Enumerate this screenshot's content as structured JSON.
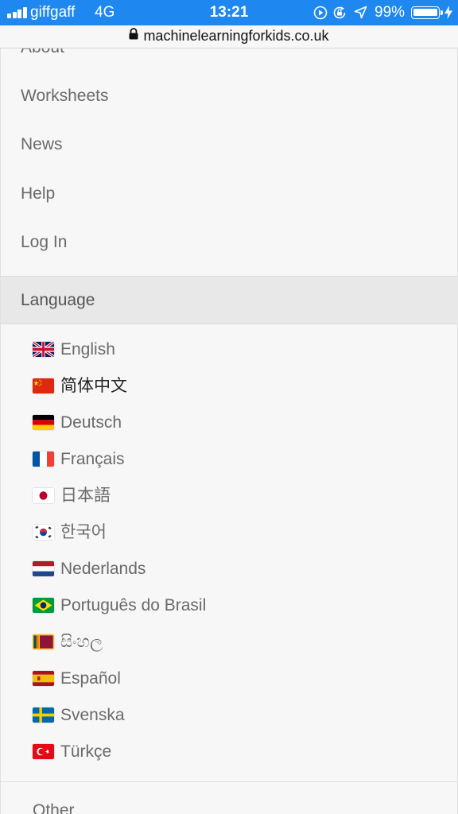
{
  "status_bar": {
    "carrier": "giffgaff",
    "network": "4G",
    "time": "13:21",
    "battery_percent_label": "99%",
    "battery_level": 0.99,
    "icons": [
      "signal-icon",
      "screen-record-icon",
      "rotation-lock-icon",
      "location-icon",
      "battery-icon",
      "charging-icon"
    ]
  },
  "browser": {
    "url": "machinelearningforkids.co.uk",
    "icons": [
      "lock-icon"
    ]
  },
  "menu": {
    "items": [
      {
        "label": "About"
      },
      {
        "label": "Worksheets"
      },
      {
        "label": "News"
      },
      {
        "label": "Help"
      },
      {
        "label": "Log In"
      }
    ],
    "language_header": "Language",
    "languages": [
      {
        "label": "English",
        "flag": "flag-uk-icon"
      },
      {
        "label": "简体中文",
        "flag": "flag-china-icon"
      },
      {
        "label": "Deutsch",
        "flag": "flag-germany-icon"
      },
      {
        "label": "Français",
        "flag": "flag-france-icon"
      },
      {
        "label": "日本語",
        "flag": "flag-japan-icon"
      },
      {
        "label": "한국어",
        "flag": "flag-korea-icon"
      },
      {
        "label": "Nederlands",
        "flag": "flag-netherlands-icon"
      },
      {
        "label": "Português do Brasil",
        "flag": "flag-brazil-icon"
      },
      {
        "label": "සිංහල",
        "flag": "flag-sri-lanka-icon"
      },
      {
        "label": "Español",
        "flag": "flag-spain-icon"
      },
      {
        "label": "Svenska",
        "flag": "flag-sweden-icon"
      },
      {
        "label": "Türkçe",
        "flag": "flag-turkey-icon"
      }
    ],
    "other_label": "Other"
  },
  "colors": {
    "status_bar": "#1e88f0",
    "menu_background": "#f7f7f8",
    "language_header_background": "#e8e8e9",
    "menu_text": "#6a6a6a"
  }
}
